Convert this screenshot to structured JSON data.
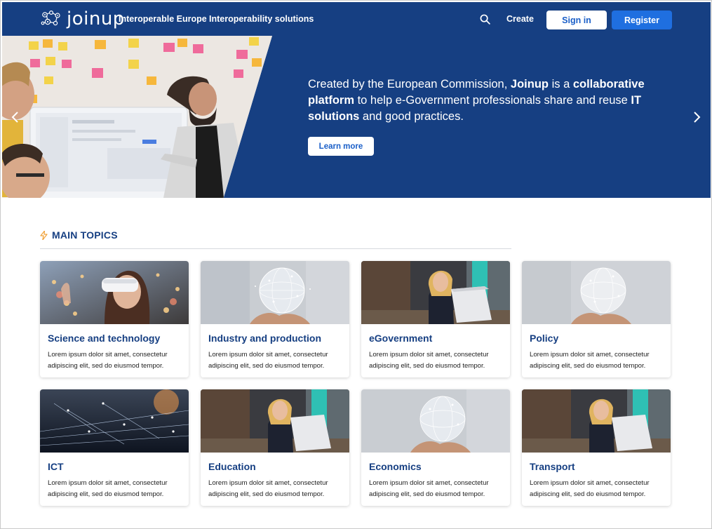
{
  "header": {
    "logo_text": "joinup",
    "nav": [
      "Interoperable Europe",
      "Interoperability solutions"
    ],
    "search_icon": "search-icon",
    "create_label": "Create",
    "signin_label": "Sign in",
    "register_label": "Register"
  },
  "hero": {
    "text_1": "Created by the European Commission, ",
    "text_brand": "Joinup",
    "text_2": " is a ",
    "text_bold_2": "collaborative platform",
    "text_3": " to help e-Government professionals share and reuse ",
    "text_bold_3": "IT solutions",
    "text_4": " and good practices.",
    "cta_label": "Learn more"
  },
  "topics": {
    "title": "MAIN TOPICS",
    "cards": [
      {
        "title": "Science and technology",
        "desc": "Lorem ipsum dolor sit amet, consectetur adipiscing elit, sed do eiusmod tempor.",
        "image": "vr-headset"
      },
      {
        "title": "Industry and production",
        "desc": "Lorem ipsum dolor sit amet, consectetur adipiscing elit, sed do eiusmod tempor.",
        "image": "globe-hands"
      },
      {
        "title": "eGovernment",
        "desc": "Lorem ipsum dolor sit amet, consectetur adipiscing elit, sed do eiusmod tempor.",
        "image": "woman-laptop"
      },
      {
        "title": "Policy",
        "desc": "Lorem ipsum dolor sit amet, consectetur adipiscing elit, sed do eiusmod tempor.",
        "image": "globe-hands"
      },
      {
        "title": "ICT",
        "desc": "Lorem ipsum dolor sit amet, consectetur adipiscing elit, sed do eiusmod tempor.",
        "image": "city-network"
      },
      {
        "title": "Education",
        "desc": "Lorem ipsum dolor sit amet, consectetur adipiscing elit, sed do eiusmod tempor.",
        "image": "woman-laptop"
      },
      {
        "title": "Economics",
        "desc": "Lorem ipsum dolor sit amet, consectetur adipiscing elit, sed do eiusmod tempor.",
        "image": "globe-hands"
      },
      {
        "title": "Transport",
        "desc": "Lorem ipsum dolor sit amet, consectetur adipiscing elit, sed do eiusmod tempor.",
        "image": "woman-laptop"
      }
    ]
  },
  "colors": {
    "brand_navy": "#163f82",
    "accent_blue": "#1f6fe0",
    "topic_icon": "#f0a23a"
  }
}
